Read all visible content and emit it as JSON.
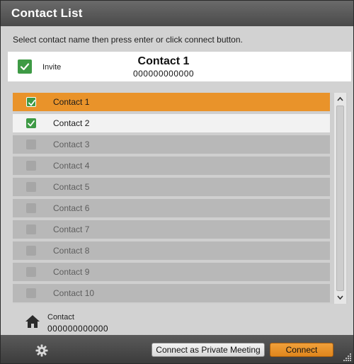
{
  "window": {
    "title": "Contact List"
  },
  "instructions": "Select contact name then press enter or click connect button.",
  "invite": {
    "label": "Invite",
    "checked": true,
    "selected_name": "Contact 1",
    "selected_number": "000000000000"
  },
  "contacts": [
    {
      "label": "Contact 1",
      "checked": true,
      "state": "selected"
    },
    {
      "label": "Contact 2",
      "checked": true,
      "state": "checked"
    },
    {
      "label": "Contact 3",
      "checked": false,
      "state": "normal"
    },
    {
      "label": "Contact 4",
      "checked": false,
      "state": "normal"
    },
    {
      "label": "Contact 5",
      "checked": false,
      "state": "normal"
    },
    {
      "label": "Contact 6",
      "checked": false,
      "state": "normal"
    },
    {
      "label": "Contact 7",
      "checked": false,
      "state": "normal"
    },
    {
      "label": "Contact 8",
      "checked": false,
      "state": "normal"
    },
    {
      "label": "Contact 9",
      "checked": false,
      "state": "normal"
    },
    {
      "label": "Contact 10",
      "checked": false,
      "state": "normal"
    }
  ],
  "footer_contact": {
    "icon": "home-icon",
    "name": "Contact",
    "number": "000000000000"
  },
  "bottom_bar": {
    "settings_icon": "gear-icon",
    "private_meeting_label": "Connect as Private Meeting",
    "connect_label": "Connect"
  },
  "colors": {
    "accent": "#e9932a",
    "check_green": "#3e9a45",
    "titlebar": "#5a5a5a"
  }
}
